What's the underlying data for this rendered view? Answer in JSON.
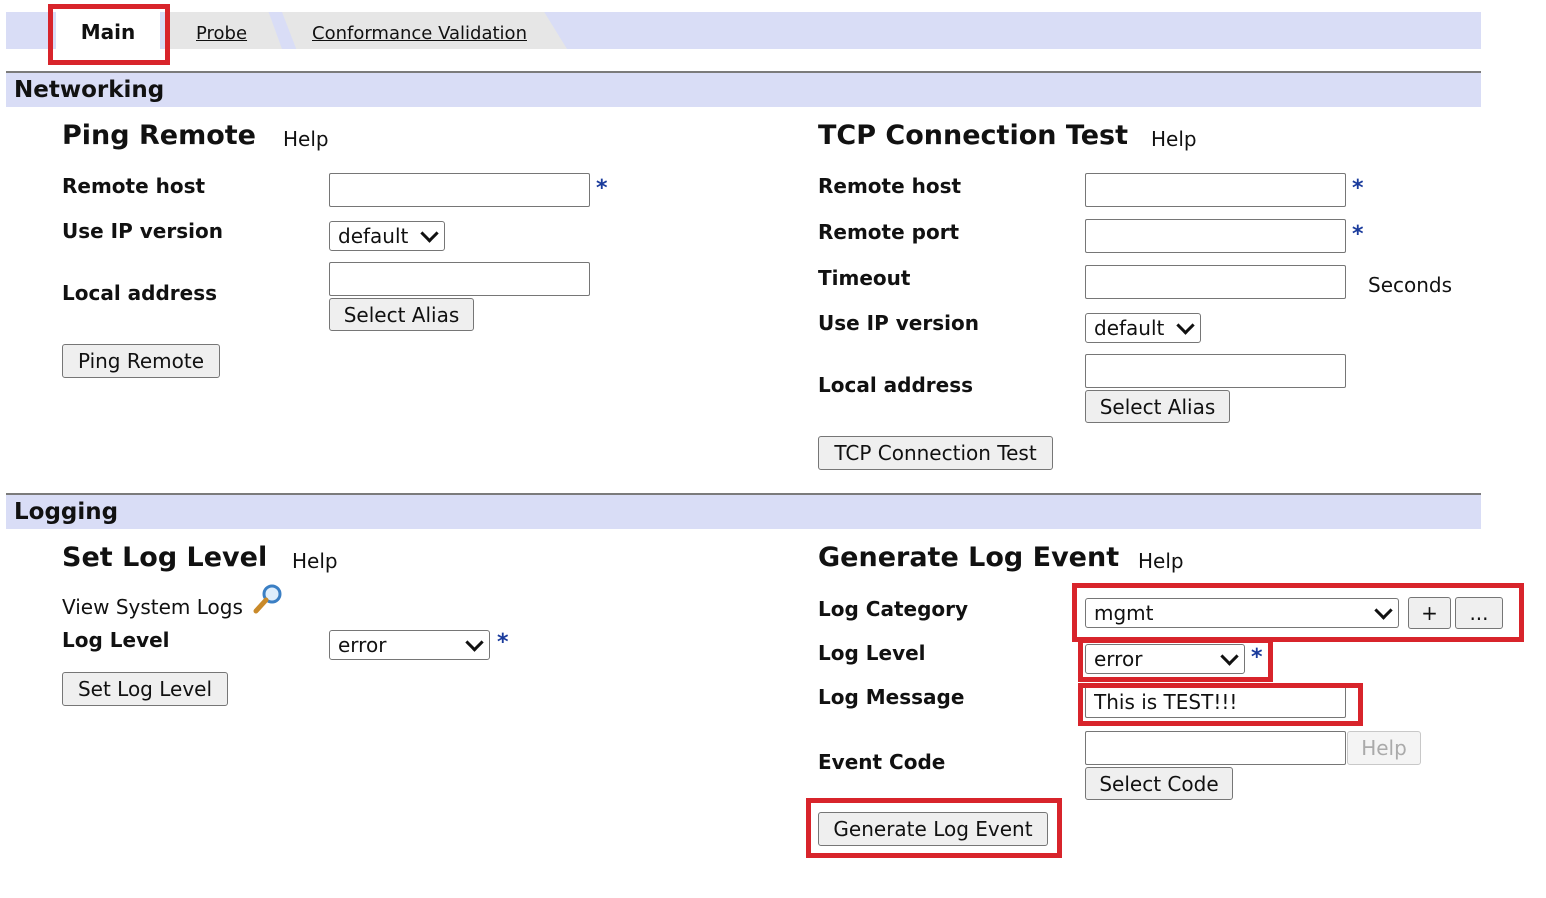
{
  "tabs": {
    "main": "Main",
    "probe": "Probe",
    "conformance": "Conformance Validation"
  },
  "networking": {
    "section_title": "Networking",
    "ping": {
      "title": "Ping Remote",
      "help": "Help",
      "remote_host_label": "Remote host",
      "remote_host_value": "",
      "ip_version_label": "Use IP version",
      "ip_version_value": "default",
      "local_address_label": "Local address",
      "local_address_value": "",
      "select_alias": "Select Alias",
      "submit": "Ping Remote"
    },
    "tcp": {
      "title": "TCP Connection Test",
      "help": "Help",
      "remote_host_label": "Remote host",
      "remote_host_value": "",
      "remote_port_label": "Remote port",
      "remote_port_value": "",
      "timeout_label": "Timeout",
      "timeout_value": "",
      "timeout_unit": "Seconds",
      "ip_version_label": "Use IP version",
      "ip_version_value": "default",
      "local_address_label": "Local address",
      "local_address_value": "",
      "select_alias": "Select Alias",
      "submit": "TCP Connection Test"
    }
  },
  "logging": {
    "section_title": "Logging",
    "set_level": {
      "title": "Set Log Level",
      "help": "Help",
      "view_logs": "View System Logs",
      "log_level_label": "Log Level",
      "log_level_value": "error",
      "submit": "Set Log Level"
    },
    "generate": {
      "title": "Generate Log Event",
      "help": "Help",
      "category_label": "Log Category",
      "category_value": "mgmt",
      "add_button": "+",
      "more_button": "...",
      "log_level_label": "Log Level",
      "log_level_value": "error",
      "message_label": "Log Message",
      "message_value": "This is TEST!!!",
      "event_code_label": "Event Code",
      "event_code_value": "",
      "help_button": "Help",
      "select_code": "Select Code",
      "submit": "Generate Log Event"
    }
  },
  "required_marker": "*",
  "colors": {
    "highlight": "#d8242b",
    "header_bg": "#d9ddf6",
    "required": "#1a3b9c"
  }
}
